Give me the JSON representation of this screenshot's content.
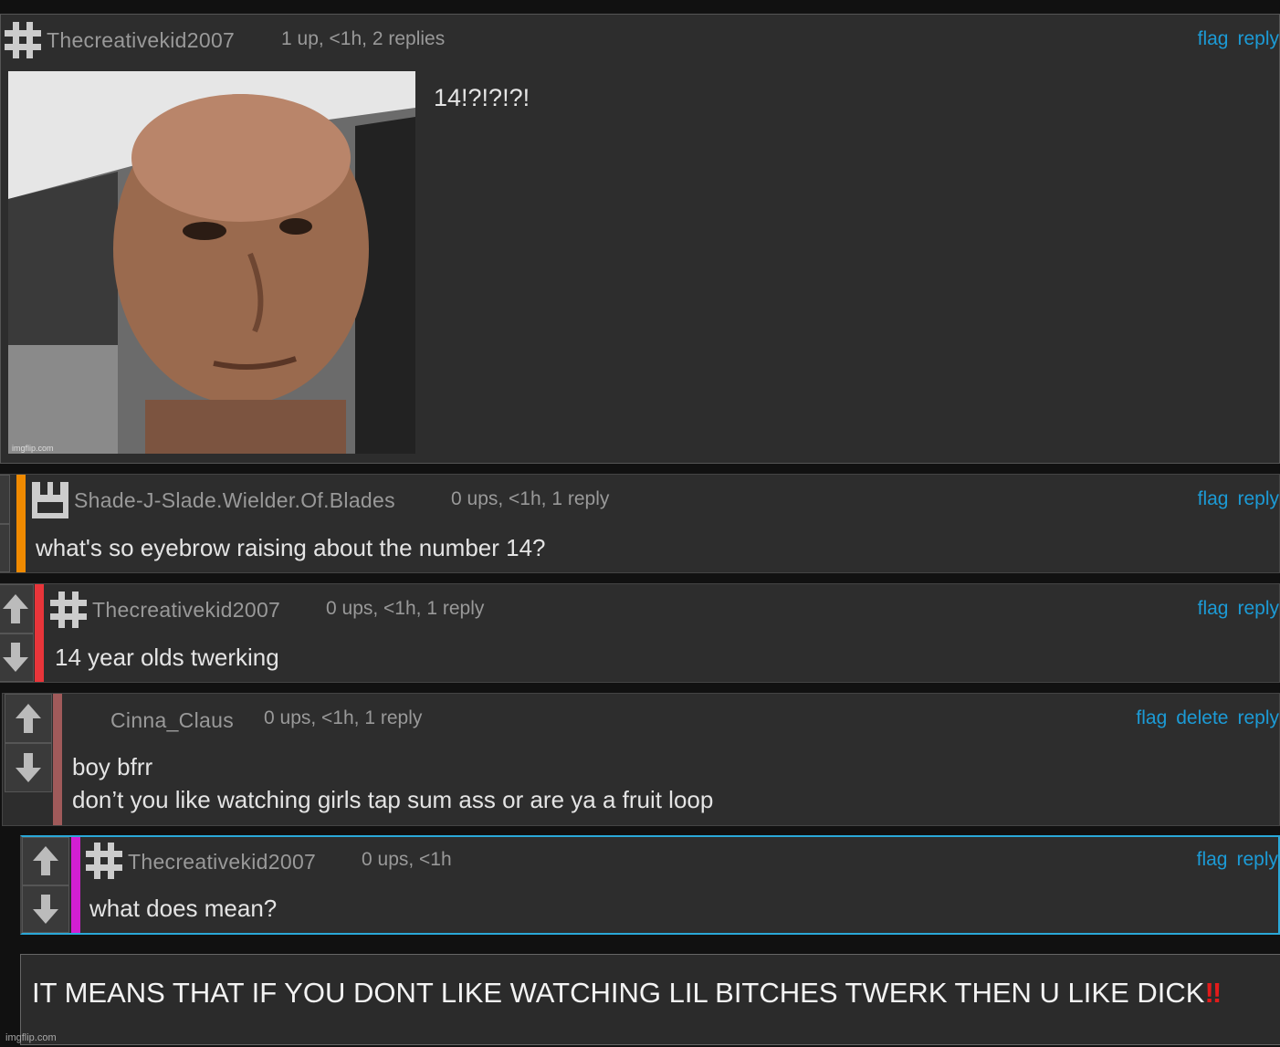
{
  "comments": [
    {
      "username": "Thecreativekid2007",
      "meta": "1 up, <1h, 2 replies",
      "actions": [
        "flag",
        "reply"
      ],
      "text": "14!?!?!?!",
      "image_watermark": "imgflip.com"
    },
    {
      "username": "Shade-J-Slade.Wielder.Of.Blades",
      "meta": "0 ups, <1h, 1 reply",
      "actions": [
        "flag",
        "reply"
      ],
      "text": "what's so eyebrow raising about the number 14?"
    },
    {
      "username": "Thecreativekid2007",
      "meta": "0 ups, <1h, 1 reply",
      "actions": [
        "flag",
        "reply"
      ],
      "text": "14 year olds twerking"
    },
    {
      "username": "Cinna_Claus",
      "meta": "0 ups, <1h, 1 reply",
      "actions": [
        "flag",
        "delete",
        "reply"
      ],
      "text_lines": [
        "boy bfrr",
        "don’t you like watching girls tap sum ass or are ya a fruit loop"
      ]
    },
    {
      "username": "Thecreativekid2007",
      "meta": "0 ups, <1h",
      "actions": [
        "flag",
        "reply"
      ],
      "text": "what does mean?"
    }
  ],
  "caption": {
    "text": "IT MEANS THAT IF YOU DONT LIKE WATCHING LIL BITCHES TWERK THEN U LIKE DICK",
    "emoji": "‼"
  },
  "watermark": "imgflip.com",
  "colors": {
    "link": "#1c9bd6",
    "depth_bars": [
      "#f08a00",
      "#e8353a",
      "#a05a5a",
      "#d21fd2"
    ],
    "highlight_border": "#2aa8d8"
  }
}
